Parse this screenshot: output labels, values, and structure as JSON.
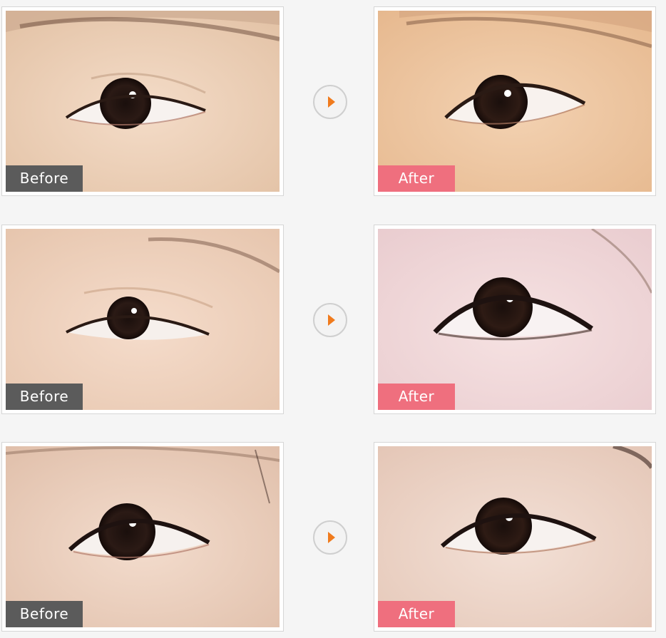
{
  "comparisons": [
    {
      "before_label": "Before",
      "after_label": "After"
    },
    {
      "before_label": "Before",
      "after_label": "After"
    },
    {
      "before_label": "Before",
      "after_label": "After"
    }
  ],
  "colors": {
    "before_badge": "#5b5b5b",
    "after_badge": "#ef6f7e",
    "arrow": "#f07b1d"
  },
  "icons": {
    "next": "play-arrow-icon"
  }
}
